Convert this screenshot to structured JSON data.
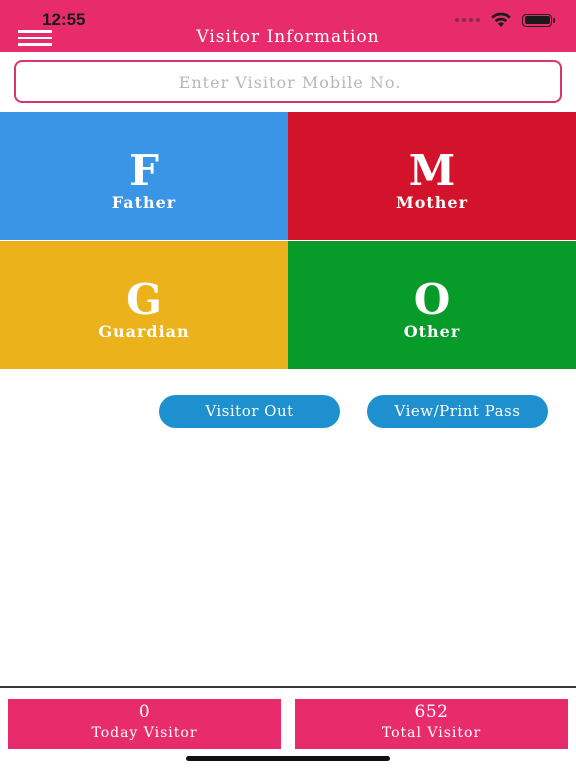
{
  "status_bar": {
    "time": "12:55",
    "signal_icon": "cellular-dots-icon",
    "wifi_icon": "wifi-icon",
    "battery_icon": "battery-icon"
  },
  "header": {
    "title": "Visitor Information",
    "menu_icon": "hamburger-menu-icon",
    "background_color": "#e82c6b"
  },
  "search": {
    "placeholder": "Enter Visitor Mobile No.",
    "value": "",
    "border_color": "#d9346f"
  },
  "visitor_types": [
    {
      "letter": "F",
      "label": "Father",
      "color": "#3b95e6"
    },
    {
      "letter": "M",
      "label": "Mother",
      "color": "#d3122b"
    },
    {
      "letter": "G",
      "label": "Guardian",
      "color": "#ecb21b"
    },
    {
      "letter": "O",
      "label": "Other",
      "color": "#079b2a"
    }
  ],
  "actions": {
    "visitor_out_label": "Visitor Out",
    "view_print_label": "View/Print Pass",
    "button_color": "#1e8fcf"
  },
  "stats": {
    "today": {
      "value": "0",
      "label": "Today Visitor"
    },
    "total": {
      "value": "652",
      "label": "Total Visitor"
    }
  }
}
